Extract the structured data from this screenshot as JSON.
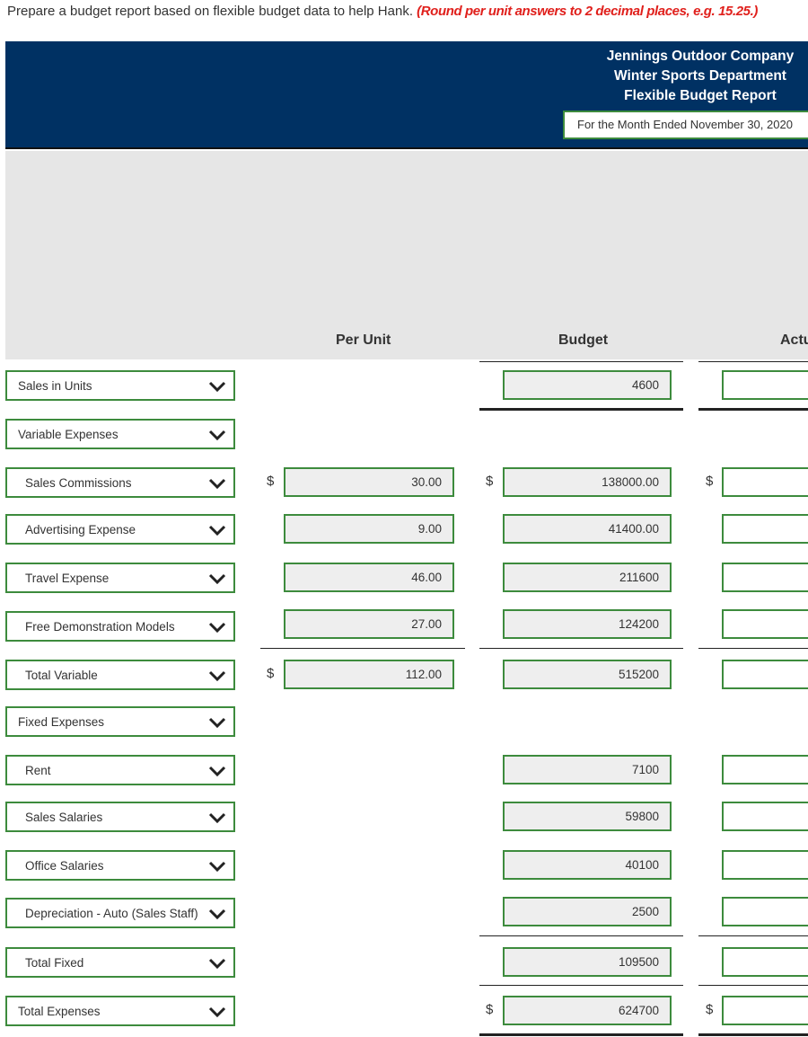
{
  "instruction": {
    "text": "Prepare a budget report based on flexible budget data to help Hank. ",
    "hint": "(Round per unit answers to 2 decimal places, e.g. 15.25.)"
  },
  "header": {
    "company": "Jennings Outdoor Company",
    "department": "Winter Sports Department",
    "report": "Flexible Budget Report",
    "period": "For the Month Ended November 30, 2020"
  },
  "columns": {
    "per_unit": "Per Unit",
    "budget": "Budget",
    "actual": "Actu"
  },
  "currency_symbol": "$",
  "rows": {
    "sales_units": {
      "label": "Sales in Units",
      "budget": "4600"
    },
    "variable_header": {
      "label": "Variable Expenses"
    },
    "sales_commissions": {
      "label": "Sales Commissions",
      "per_unit": "30.00",
      "budget": "138000.00"
    },
    "advertising": {
      "label": "Advertising Expense",
      "per_unit": "9.00",
      "budget": "41400.00"
    },
    "travel": {
      "label": "Travel Expense",
      "per_unit": "46.00",
      "budget": "211600"
    },
    "demo_models": {
      "label": "Free Demonstration Models",
      "per_unit": "27.00",
      "budget": "124200"
    },
    "total_variable": {
      "label": "Total Variable",
      "per_unit": "112.00",
      "budget": "515200"
    },
    "fixed_header": {
      "label": "Fixed Expenses"
    },
    "rent": {
      "label": "Rent",
      "budget": "7100"
    },
    "sales_salaries": {
      "label": "Sales Salaries",
      "budget": "59800"
    },
    "office_salaries": {
      "label": "Office Salaries",
      "budget": "40100"
    },
    "depreciation": {
      "label": "Depreciation - Auto (Sales Staff)",
      "budget": "2500"
    },
    "total_fixed": {
      "label": "Total Fixed",
      "budget": "109500"
    },
    "total_expenses": {
      "label": "Total Expenses",
      "budget": "624700"
    }
  },
  "colors": {
    "banner": "#003163",
    "border_green": "#3d8b3d",
    "hint_red": "#e0201c"
  }
}
